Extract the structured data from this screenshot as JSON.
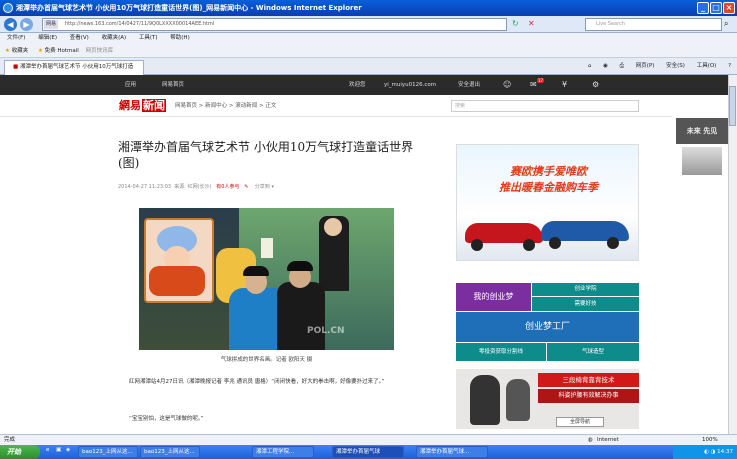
{
  "window": {
    "title": "湘潭举办首届气球艺术节 小伙用10万气球打造童话世界(图)_网易新闻中心 - Windows Internet Explorer"
  },
  "address": {
    "tag": "网易",
    "url": "http://news.163.com/14/0427/11/9Q0LXXXX00014AEE.html",
    "search_placeholder": "Live Search"
  },
  "menu": [
    "文件(F)",
    "编辑(E)",
    "查看(V)",
    "收藏夹(A)",
    "工具(T)",
    "帮助(H)"
  ],
  "favbar": {
    "label": "收藏夹",
    "items": [
      "免费 Hotmail",
      "网页快讯库"
    ]
  },
  "tab": {
    "label": "湘潭举办首届气球艺术节 小伙用10万气球打造"
  },
  "tools": [
    "网页(P)",
    "安全(S)",
    "工具(O)"
  ],
  "site": {
    "topnav": [
      "应用",
      "网易首页"
    ],
    "user": "欢迎您",
    "email": "yi_muiyu0126.com",
    "logout": "安全退出",
    "mail_count": "17",
    "logo_a": "網易",
    "logo_b": "新闻",
    "crumbs": [
      "网易首页",
      "新闻中心",
      "滚动新闻",
      "正文"
    ],
    "search_placeholder": "搜索"
  },
  "article": {
    "title": "湘潭举办首届气球艺术节 小伙用10万气球打造童话世界(图)",
    "time": "2014-04-27 11:23:03",
    "source": "来源: 红网(长沙)",
    "comments": "有0人参与",
    "share": "分享到",
    "photo_watermark": "POL.CN",
    "caption": "气球拼成的世界名画。记者 欧阳天 摄",
    "p1": "红网湘潭站4月27日讯（湘潭晚报记者 李兆 通讯员 唐格）“闭闭快看，好大的拳击啊，好像要扑过来了。”",
    "p2": "“宝宝别怕，这是气球做的呢。”"
  },
  "ads": {
    "ad1_line1": "赛欧携手爱唯欧",
    "ad1_line2": "推出暖春金融购车季",
    "ad2_main": "我的创业梦",
    "ad2_r1": "创业学院",
    "ad2_r2": "需要好技",
    "ad2_mid": "创业梦工厂",
    "ad2_b1": "零投资获取分割线",
    "ad2_b2": "气球造型",
    "ad3_line1": "三段椅背靠背技术",
    "ad3_line2": "科姿护腰有效解决办事",
    "ad3_tag": "全屏导航",
    "right_ad": "未来 先见"
  },
  "status": {
    "left": "完成",
    "zone": "Internet",
    "zoom": "100%"
  },
  "taskbar": {
    "start": "开始",
    "tasks": [
      "bao123_上网从这...",
      "bao123_上网从这...",
      "湘潭工程学院...",
      "湘潭举办首届气球",
      "湘潭举办首届气球..."
    ],
    "clock": "14:37"
  },
  "colors": {
    "titlebar": "#0a5fd8",
    "nav_dark": "#2b2b2b",
    "brand_red": "#cc0000",
    "teal": "#0e8c8c"
  }
}
